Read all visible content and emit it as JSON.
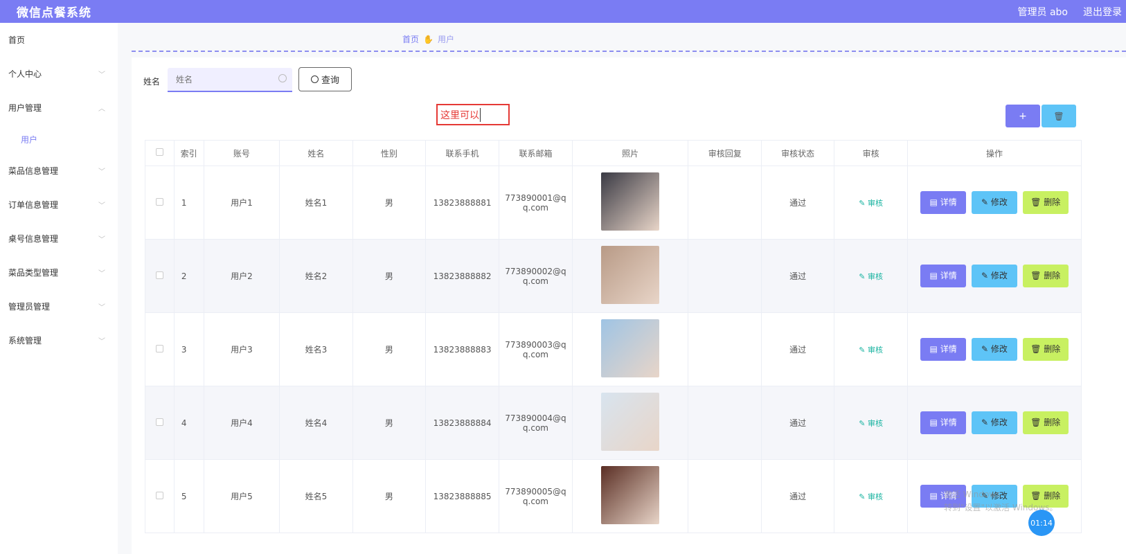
{
  "app": {
    "title": "微信点餐系统",
    "admin": "管理员 abo",
    "logout": "退出登录"
  },
  "sidebar": {
    "items": [
      {
        "label": "首页",
        "chevron": ""
      },
      {
        "label": "个人中心",
        "chevron": "﹀"
      },
      {
        "label": "用户管理",
        "chevron": "︿"
      },
      {
        "label": "菜品信息管理",
        "chevron": "﹀"
      },
      {
        "label": "订单信息管理",
        "chevron": "﹀"
      },
      {
        "label": "桌号信息管理",
        "chevron": "﹀"
      },
      {
        "label": "菜品类型管理",
        "chevron": "﹀"
      },
      {
        "label": "管理员管理",
        "chevron": "﹀"
      },
      {
        "label": "系统管理",
        "chevron": "﹀"
      }
    ],
    "sub_item": "用户"
  },
  "breadcrumb": {
    "home": "首页",
    "current": "用户"
  },
  "search": {
    "label": "姓名",
    "placeholder": "姓名",
    "button": "查询"
  },
  "annotation": {
    "text": "这里可以"
  },
  "toolbar": {
    "add": "+",
    "delete": "🗑"
  },
  "table": {
    "headers": [
      "索引",
      "账号",
      "姓名",
      "性别",
      "联系手机",
      "联系邮箱",
      "照片",
      "审核回复",
      "审核状态",
      "审核",
      "操作"
    ],
    "rows": [
      {
        "index": "1",
        "account": "用户1",
        "name": "姓名1",
        "gender": "男",
        "phone": "13823888881",
        "email_a": "773890001@q",
        "email_b": "q.com",
        "reply": "",
        "status": "通过",
        "audit": "审核",
        "photo_color": "#3a3a44"
      },
      {
        "index": "2",
        "account": "用户2",
        "name": "姓名2",
        "gender": "男",
        "phone": "13823888882",
        "email_a": "773890002@q",
        "email_b": "q.com",
        "reply": "",
        "status": "通过",
        "audit": "审核",
        "photo_color": "#b89a86"
      },
      {
        "index": "3",
        "account": "用户3",
        "name": "姓名3",
        "gender": "男",
        "phone": "13823888883",
        "email_a": "773890003@q",
        "email_b": "q.com",
        "reply": "",
        "status": "通过",
        "audit": "审核",
        "photo_color": "#9fc4e4"
      },
      {
        "index": "4",
        "account": "用户4",
        "name": "姓名4",
        "gender": "男",
        "phone": "13823888884",
        "email_a": "773890004@q",
        "email_b": "q.com",
        "reply": "",
        "status": "通过",
        "audit": "审核",
        "photo_color": "#d8e4ef"
      },
      {
        "index": "5",
        "account": "用户5",
        "name": "姓名5",
        "gender": "男",
        "phone": "13823888885",
        "email_a": "773890005@q",
        "email_b": "q.com",
        "reply": "",
        "status": "通过",
        "audit": "审核",
        "photo_color": "#5a2e24"
      }
    ],
    "actions": {
      "detail": "详情",
      "edit": "修改",
      "remove": "删除"
    }
  },
  "overlay": {
    "watermark_1": "激活 Windows",
    "watermark_2": "转到\"设置\"以激活 Windows。",
    "clock": "01:14"
  }
}
